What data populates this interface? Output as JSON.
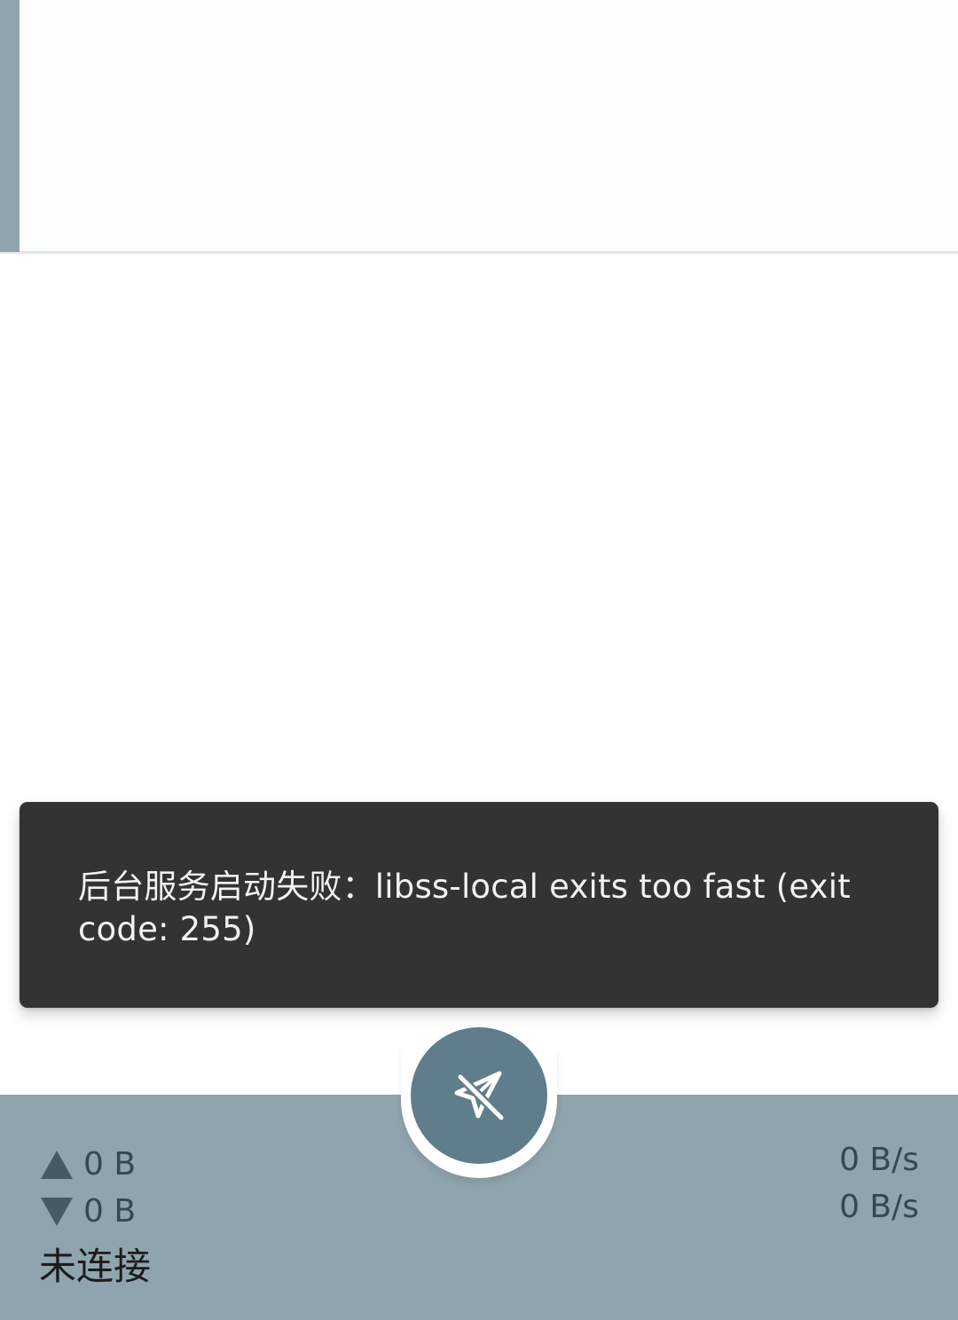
{
  "snackbar": {
    "message": "后台服务启动失败：libss-local exits too fast (exit code: 255)"
  },
  "fab": {
    "icon": "plane-off-icon",
    "state": "disconnected"
  },
  "stats": {
    "upload_total": "0 B",
    "download_total": "0 B",
    "upload_speed": "0 B/s",
    "download_speed": "0 B/s",
    "status": "未连接"
  },
  "colors": {
    "accent": "#90a4ae",
    "fab": "#607d8b",
    "snackbar": "#333333"
  }
}
